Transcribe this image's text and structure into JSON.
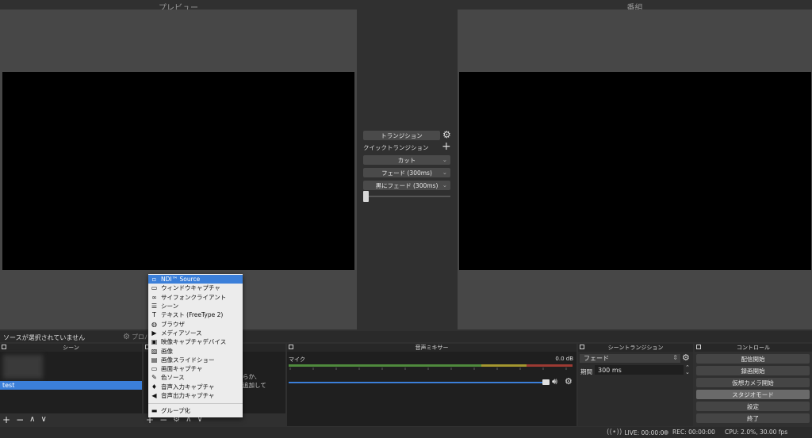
{
  "preview": {
    "title": "プレビュー"
  },
  "program": {
    "title": "番組"
  },
  "transition_panel": {
    "transition_button": "トランジション",
    "quick_transition_label": "クイックトランジション",
    "cut": "カット",
    "fade": "フェード (300ms)",
    "fade_black": "黒にフェード (300ms)"
  },
  "source_toolbar": {
    "no_source": "ソースが選択されていません",
    "properties": "プロパ"
  },
  "scenes": {
    "title": "シーン",
    "items": [
      "test"
    ]
  },
  "sources": {
    "hint_fragments": [
      "らか、",
      "追加して"
    ]
  },
  "add_source_menu": {
    "items": [
      {
        "label": "NDI™ Source",
        "icon": "file-icon",
        "glyph": "▫"
      },
      {
        "label": "ウィンドウキャプチャ",
        "icon": "window-icon",
        "glyph": "▭"
      },
      {
        "label": "サイフォンクライアント",
        "icon": "syphon-icon",
        "glyph": "∞"
      },
      {
        "label": "シーン",
        "icon": "list-icon",
        "glyph": "☰"
      },
      {
        "label": "テキスト (FreeType 2)",
        "icon": "text-icon",
        "glyph": "T"
      },
      {
        "label": "ブラウザ",
        "icon": "globe-icon",
        "glyph": "◍"
      },
      {
        "label": "メディアソース",
        "icon": "play-icon",
        "glyph": "▶"
      },
      {
        "label": "映像キャプチャデバイス",
        "icon": "camera-icon",
        "glyph": "▣"
      },
      {
        "label": "画像",
        "icon": "image-icon",
        "glyph": "▨"
      },
      {
        "label": "画像スライドショー",
        "icon": "slideshow-icon",
        "glyph": "▤"
      },
      {
        "label": "画面キャプチャ",
        "icon": "monitor-icon",
        "glyph": "▭"
      },
      {
        "label": "色ソース",
        "icon": "brush-icon",
        "glyph": "✎"
      },
      {
        "label": "音声入力キャプチャ",
        "icon": "mic-icon",
        "glyph": "♦"
      },
      {
        "label": "音声出力キャプチャ",
        "icon": "speaker-icon",
        "glyph": "◀"
      }
    ],
    "group_label": "グループ化"
  },
  "mixer": {
    "title": "音声ミキサー",
    "channel_name": "マイク",
    "level": "0.0 dB"
  },
  "scene_transitions": {
    "title": "シーントランジション",
    "selected": "フェード",
    "duration_label": "期間",
    "duration_value": "300 ms"
  },
  "controls": {
    "title": "コントロール",
    "buttons": [
      "配信開始",
      "録画開始",
      "仮想カメラ開始",
      "スタジオモード",
      "設定",
      "終了"
    ]
  },
  "status": {
    "live": "LIVE: 00:00:00",
    "rec": "REC: 00:00:00",
    "cpu": "CPU: 2.0%, 30.00 fps"
  },
  "colors": {
    "accent": "#3b7fd9",
    "meter_green": "#5fb84a",
    "meter_yellow": "#d2c23c",
    "meter_red": "#c8463c"
  }
}
